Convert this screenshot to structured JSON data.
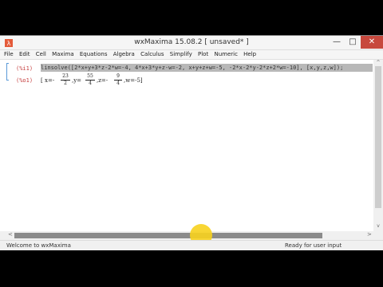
{
  "window": {
    "title": "wxMaxima 15.08.2 [ unsaved* ]",
    "minimize": "—",
    "maximize": "□",
    "close": "✕"
  },
  "menu": [
    "File",
    "Edit",
    "Cell",
    "Maxima",
    "Equations",
    "Algebra",
    "Calculus",
    "Simplify",
    "Plot",
    "Numeric",
    "Help"
  ],
  "cell": {
    "input_label": "(%i1)",
    "output_label": "(%o1)",
    "input": "linsolve([2*x+y+3*z-2*w=-4, 4*x+3*y+z-w=-2, x+y+z+w=-5, -2*x-2*y-2*z+2*w=-10], [x,y,z,w]);",
    "output": {
      "open": "[",
      "x_prefix": "x=-",
      "x_num": "23",
      "x_den": "2",
      "y_prefix": ",y=",
      "y_num": "55",
      "y_den": "4",
      "z_prefix": ",z=-",
      "z_num": "9",
      "z_den": "4",
      "w_part": ",w=-5]"
    }
  },
  "status": {
    "left": "Welcome to wxMaxima",
    "right": "Ready for user input"
  },
  "scroll": {
    "left_arrow": "<",
    "right_arrow": ">",
    "up_arrow": "^",
    "down_arrow": "v"
  },
  "colors": {
    "label": "#c64040",
    "bracket": "#5a9ad8",
    "close": "#c7483d",
    "cursor_highlight": "#f7d21e"
  }
}
